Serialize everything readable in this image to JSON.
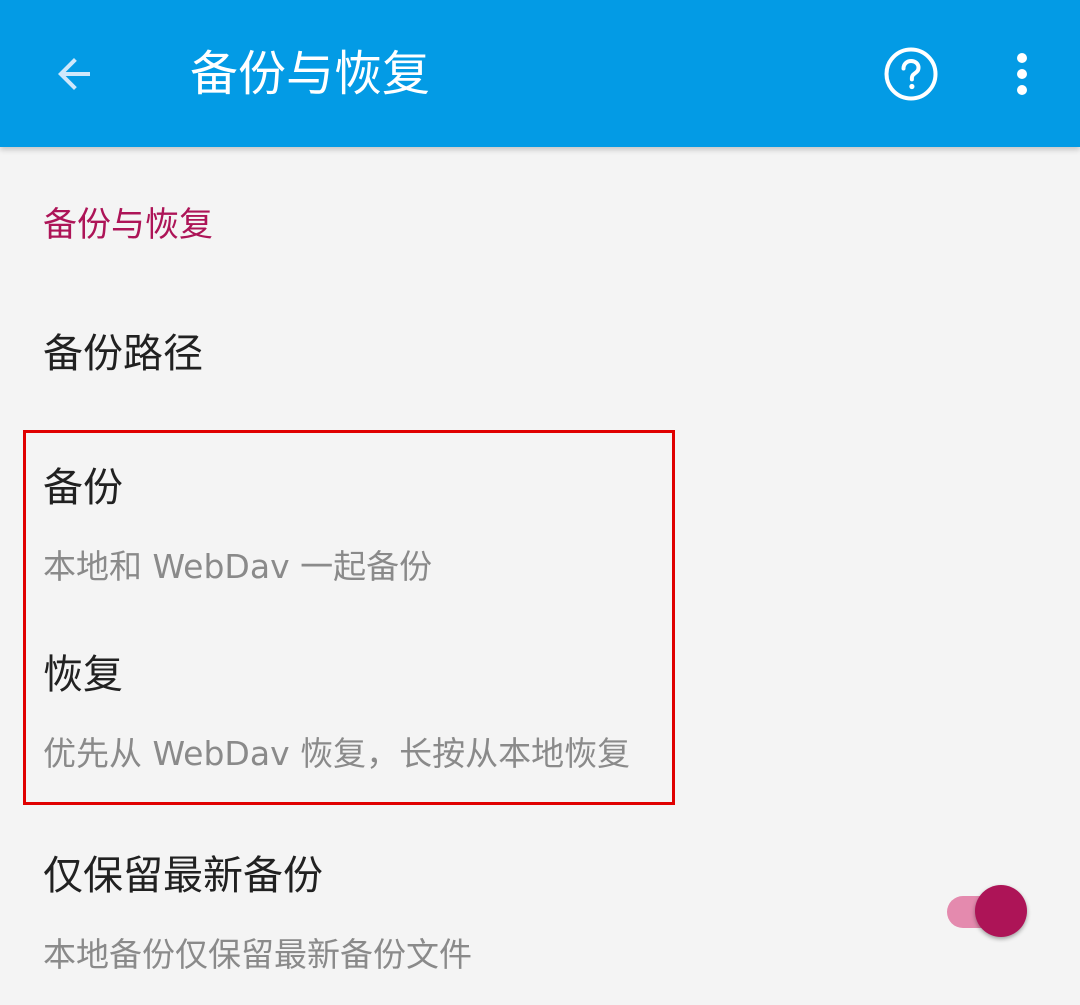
{
  "toolbar": {
    "title": "备份与恢复",
    "back_icon": "arrow-back-icon",
    "help_icon": "help-circle-icon",
    "more_icon": "more-vert-icon",
    "background_color": "#039be5"
  },
  "category": {
    "title": "备份与恢复",
    "color": "#ad1457"
  },
  "preferences": {
    "backup_path": {
      "title": "备份路径"
    },
    "backup": {
      "title": "备份",
      "summary": "本地和 WebDav 一起备份"
    },
    "restore": {
      "title": "恢复",
      "summary": "优先从 WebDav 恢复，长按从本地恢复"
    },
    "keep_latest": {
      "title": "仅保留最新备份",
      "summary": "本地备份仅保留最新备份文件",
      "enabled": true
    }
  },
  "highlight_color": "#e00000"
}
